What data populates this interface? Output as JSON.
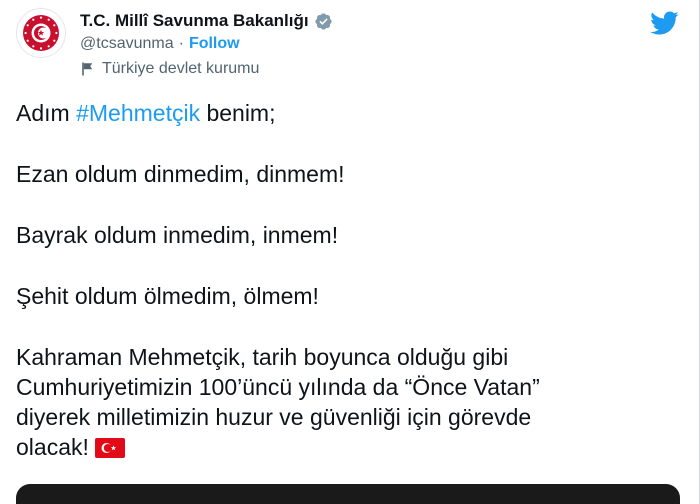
{
  "account": {
    "name": "T.C. Millî Savunma Bakanlığı",
    "handle": "@tcsavunma",
    "separator": "·",
    "follow_label": "Follow",
    "label": "Türkiye devlet kurumu"
  },
  "tweet": {
    "line1_prefix": "Adım ",
    "line1_hashtag": "#Mehmetçik",
    "line1_suffix": " benim;",
    "line2": "Ezan oldum dinmedim, dinmem!",
    "line3": "Bayrak oldum inmedim, inmem!",
    "line4": "Şehit oldum ölmedim, ölmem!",
    "p5_line1": "Kahraman Mehmetçik, tarih boyunca olduğu gibi",
    "p5_line2": "Cumhuriyetimizin 100’üncü yılında da “Önce Vatan”",
    "p5_line3": "diyerek milletimizin huzur ve güvenliği için görevde",
    "p5_line4": "olacak!"
  },
  "icons": {
    "verified": "verified-badge-icon",
    "label": "flag-outline-icon",
    "brand": "twitter-bird-icon",
    "emoji": "turkey-flag-emoji"
  },
  "colors": {
    "link": "#1d9bf0",
    "verified_badge": "#829aab",
    "text": "#0f1419",
    "secondary": "#536471",
    "flag_red": "#e30a17"
  }
}
